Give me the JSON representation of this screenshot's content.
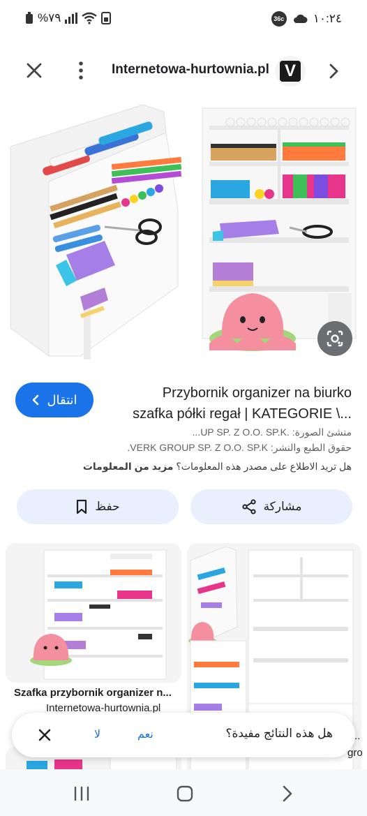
{
  "status_bar": {
    "battery": "%٧٩",
    "time": "١٠:٢٤",
    "badge": "36c"
  },
  "nav": {
    "site": "Internetowa-hurtownia.pl",
    "favicon_letter": "V"
  },
  "result": {
    "visit_label": "انتقال",
    "title_line1": "Przybornik organizer na biurko",
    "title_line2": "szafka półki regał | KATEGORIE \\...",
    "creator_line": "منشئ الصورة: .UP SP. Z O.O. SP.K...",
    "copyright_line": "حقوق الطبع والنشر: VERK GROUP SP. Z O.O. SP.K.",
    "learn_text": "هل تريد الاطلاع على مصدر هذه المعلومات؟",
    "learn_link": "مزيد من المعلومات"
  },
  "actions": {
    "share_label": "مشاركة",
    "save_label": "حفظ"
  },
  "related": {
    "card1_title": "Szafka przybornik organizer n...",
    "card1_site": "Internetowa-hurtownia.pl",
    "card2_fragment1": "..",
    "card2_fragment2": "gro"
  },
  "feedback": {
    "question": "هل هذه النتائج مفيدة؟",
    "yes": "نعم",
    "no": "لا"
  },
  "colors": {
    "accent": "#1a73e8",
    "chip_bg": "#e8f0fe",
    "plush": "#f48fa0"
  }
}
